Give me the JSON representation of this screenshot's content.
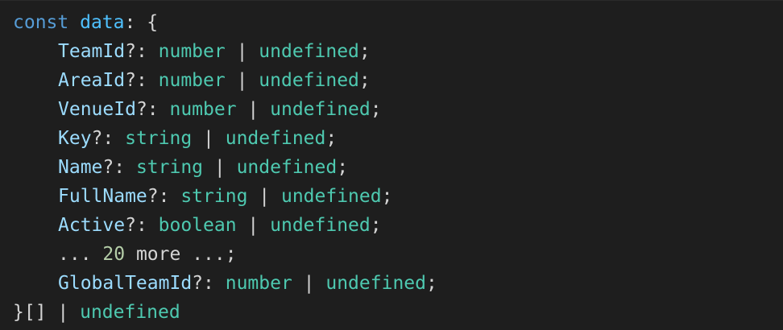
{
  "header": {
    "keyword": "const",
    "name": "data",
    "sep": ": {"
  },
  "fields": [
    {
      "name": "TeamId",
      "q": "?: ",
      "type": "number",
      "pipe": " | ",
      "undef": "undefined",
      "semi": ";"
    },
    {
      "name": "AreaId",
      "q": "?: ",
      "type": "number",
      "pipe": " | ",
      "undef": "undefined",
      "semi": ";"
    },
    {
      "name": "VenueId",
      "q": "?: ",
      "type": "number",
      "pipe": " | ",
      "undef": "undefined",
      "semi": ";"
    },
    {
      "name": "Key",
      "q": "?: ",
      "type": "string",
      "pipe": " | ",
      "undef": "undefined",
      "semi": ";"
    },
    {
      "name": "Name",
      "q": "?: ",
      "type": "string",
      "pipe": " | ",
      "undef": "undefined",
      "semi": ";"
    },
    {
      "name": "FullName",
      "q": "?: ",
      "type": "string",
      "pipe": " | ",
      "undef": "undefined",
      "semi": ";"
    }
  ],
  "active": {
    "name": "Active",
    "q": "?: ",
    "type": "boolean",
    "pipe": " | ",
    "undef": "undefined",
    "semi": ";"
  },
  "more": {
    "dots1": "... ",
    "count": "20",
    "text": " more ",
    "dots2": "...;"
  },
  "last_field": {
    "name": "GlobalTeamId",
    "q": "?: ",
    "type": "number",
    "pipe": " | ",
    "undef": "undefined",
    "semi": ";"
  },
  "footer": {
    "close": "}[] | ",
    "undef": "undefined"
  },
  "colors": {
    "background": "#1e1e1e",
    "keyword": "#569cd6",
    "variable": "#4fc1ff",
    "property": "#9cdcfe",
    "type": "#4ec9b0",
    "number": "#b5cea8",
    "punctuation": "#d4d4d4"
  }
}
